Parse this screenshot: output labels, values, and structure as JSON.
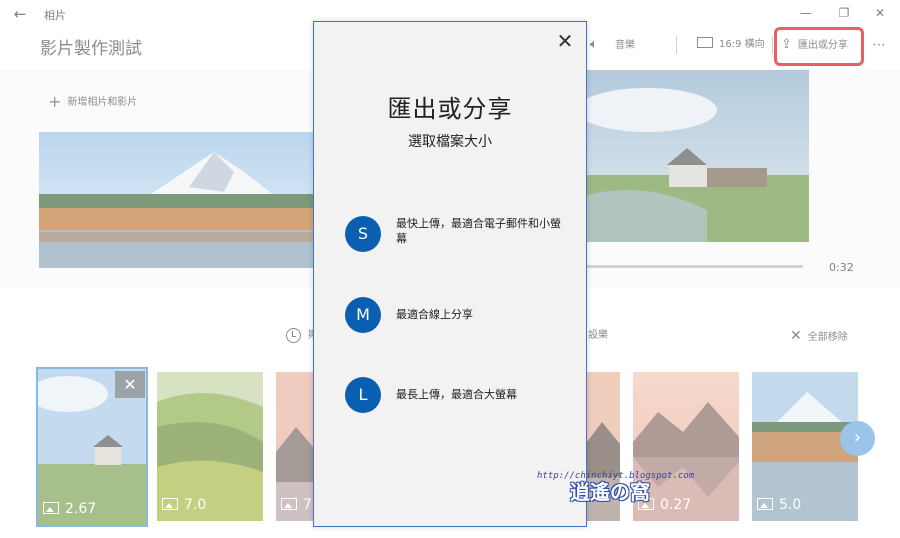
{
  "app": {
    "back_glyph": "←",
    "title": "相片",
    "project_title": "影片製作測試"
  },
  "window": {
    "minimize": "—",
    "maximize": "❐",
    "close": "✕"
  },
  "toolbar": {
    "audio_label": "音樂",
    "aspect_label": "16:9 橫向",
    "export_label": "匯出或分享",
    "more_glyph": "⋯",
    "export_highlight_color": "#e0141e"
  },
  "library": {
    "add_label": "新增相片和影片"
  },
  "preview": {
    "timecode": "0:32"
  },
  "storyboard": {
    "partial_left_label": "期",
    "partial_mid_label": "設樂",
    "remove_all_label": "全部移除",
    "close_glyph": "✕",
    "next_glyph": "›",
    "thumbs": [
      {
        "duration": "2.67"
      },
      {
        "duration": "7.0"
      },
      {
        "duration": "7"
      },
      {
        "duration": ""
      },
      {
        "duration": "0.27"
      },
      {
        "duration": "5.0"
      }
    ]
  },
  "dialog": {
    "close_glyph": "✕",
    "title": "匯出或分享",
    "subtitle": "選取檔案大小",
    "accent_color": "#0b5fb0",
    "options": [
      {
        "letter": "S",
        "label": "最快上傳，最適合電子郵件和小螢幕"
      },
      {
        "letter": "M",
        "label": "最適合線上分享"
      },
      {
        "letter": "L",
        "label": "最長上傳，最適合大螢幕"
      }
    ]
  },
  "watermark": {
    "url": "http://chinchiyt.blogspot.com",
    "logo": "逍遙の窩"
  }
}
